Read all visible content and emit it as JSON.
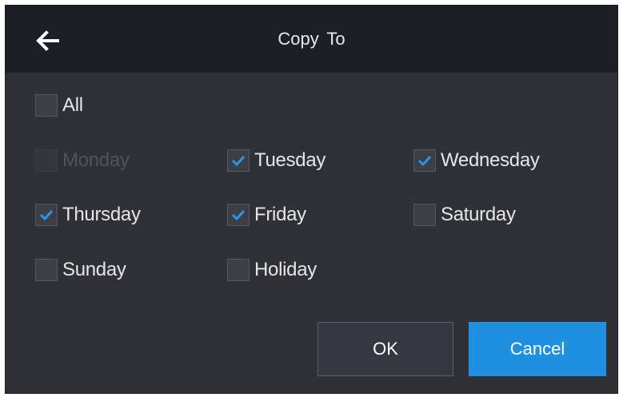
{
  "dialog": {
    "title": "Copy To",
    "back_icon": "back-arrow-icon"
  },
  "colors": {
    "header_bg": "#1c1f26",
    "body_bg": "#2f3136",
    "check_color": "#2e95e6",
    "cancel_bg": "#1f8fe0"
  },
  "options": {
    "all": {
      "label": "All",
      "checked": false,
      "disabled": false
    },
    "monday": {
      "label": "Monday",
      "checked": false,
      "disabled": true
    },
    "tuesday": {
      "label": "Tuesday",
      "checked": true,
      "disabled": false
    },
    "wednesday": {
      "label": "Wednesday",
      "checked": true,
      "disabled": false
    },
    "thursday": {
      "label": "Thursday",
      "checked": true,
      "disabled": false
    },
    "friday": {
      "label": "Friday",
      "checked": true,
      "disabled": false
    },
    "saturday": {
      "label": "Saturday",
      "checked": false,
      "disabled": false
    },
    "sunday": {
      "label": "Sunday",
      "checked": false,
      "disabled": false
    },
    "holiday": {
      "label": "Holiday",
      "checked": false,
      "disabled": false
    }
  },
  "buttons": {
    "ok_label": "OK",
    "cancel_label": "Cancel"
  }
}
